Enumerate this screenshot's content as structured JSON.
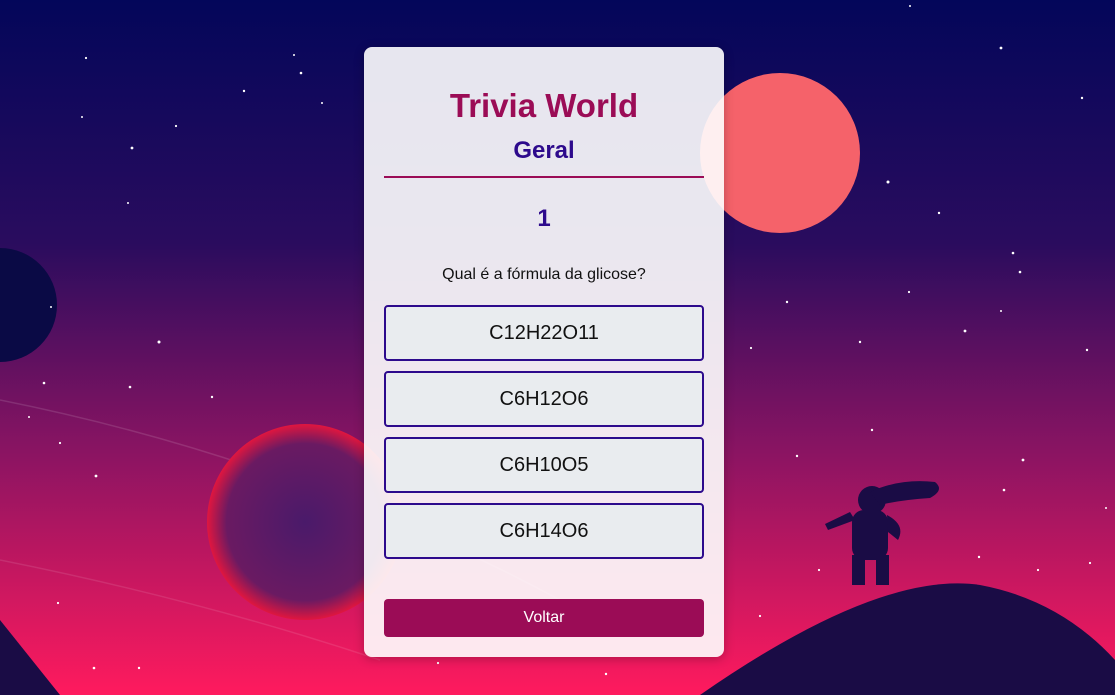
{
  "app": {
    "title": "Trivia World"
  },
  "quiz": {
    "category": "Geral",
    "question_number": "1",
    "question": "Qual é a fórmula da glicose?",
    "options": [
      "C12H22O11",
      "C6H12O6",
      "C6H10O5",
      "C6H14O6"
    ],
    "back_label": "Voltar"
  },
  "colors": {
    "accent": "#9b0c56",
    "secondary": "#2d0a8c",
    "option_bg": "#e9ecef"
  }
}
